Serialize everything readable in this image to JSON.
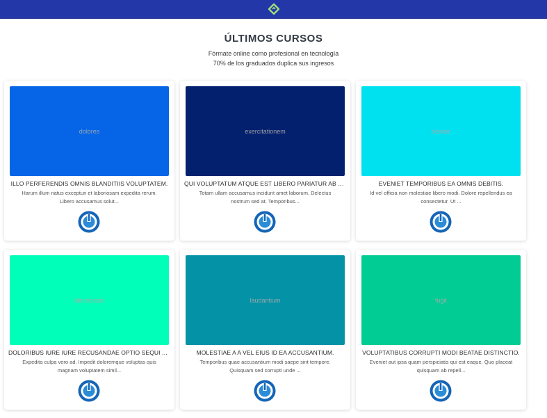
{
  "header": {
    "logo_icon": "diamond-logo-icon",
    "accent": "#2437a8"
  },
  "section": {
    "title": "ÚLTIMOS CURSOS",
    "subtitle_1": "Fórmate online como profesional en tecnología",
    "subtitle_2": "70% de los graduados duplica sus ingresos"
  },
  "courses": [
    {
      "thumb_label": "dolores",
      "thumb_color": "#0565e6",
      "title": "ILLO PERFERENDIS OMNIS BLANDITIIS VOLUPTATEM.",
      "description": "Harum illum natus excepturi et laboriosam expedita rerum. Libero accusamus solut...",
      "button_icon": "power-icon"
    },
    {
      "thumb_label": "exercitationem",
      "thumb_color": "#03206e",
      "title": "QUI VOLUPTATUM ATQUE EST LIBERO PARIATUR AB QU...",
      "description": "Totam ullam accusamus incidunt amet laborum. Delectus nostrum sed at. Temporibus...",
      "button_icon": "power-icon"
    },
    {
      "thumb_label": "beatae",
      "thumb_color": "#00e1ef",
      "title": "EVENIET TEMPORIBUS EA OMNIS DEBITIS.",
      "description": "Id vel officia non molestiae libero modi. Dolore repellendus ea consectetur. Ut ...",
      "button_icon": "power-icon"
    },
    {
      "thumb_label": "laboriosam",
      "thumb_color": "#00ffb8",
      "title": "DOLORIBUS IURE IURE RECUSANDAE OPTIO SEQUI AUT.",
      "description": "Expedita culpa vero ad. Impedit doloremque voluptas quis magnam voluptatem simil...",
      "button_icon": "power-icon"
    },
    {
      "thumb_label": "laudantium",
      "thumb_color": "#0392a6",
      "title": "MOLESTIAE A A VEL EIUS ID EA ACCUSANTIUM.",
      "description": "Temporibus quae accusantium modi saepe sint tempore. Quisquam sed corrupti unde ...",
      "button_icon": "power-icon"
    },
    {
      "thumb_label": "fugit",
      "thumb_color": "#00cc94",
      "title": "VOLUPTATIBUS CORRUPTI MODI BEATAE DISTINCTIO.",
      "description": "Eveniet aut ipsa quam perspiciatis qui est eaque. Quo placeat quisquam ab repell...",
      "button_icon": "power-icon"
    }
  ]
}
